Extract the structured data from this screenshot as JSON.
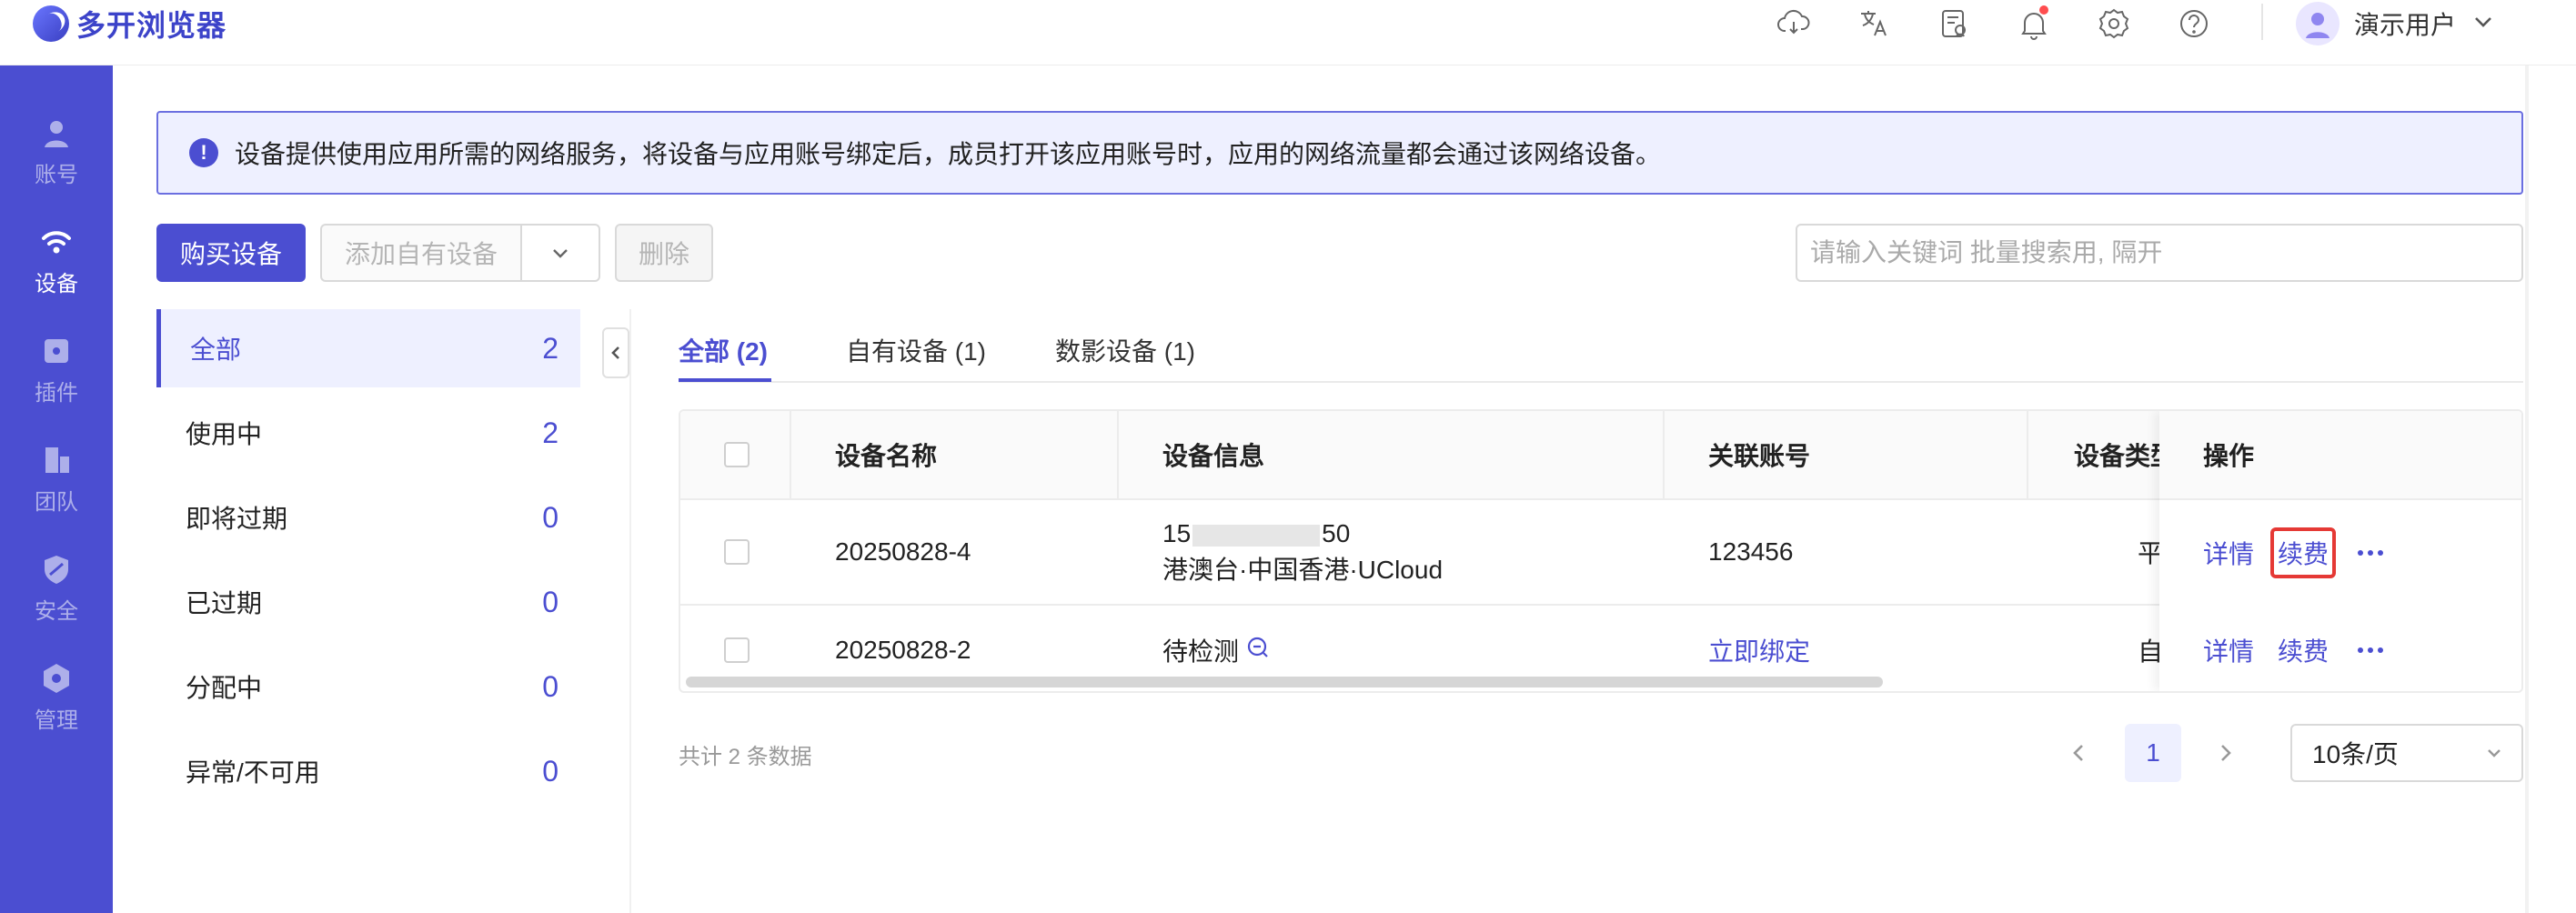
{
  "app": {
    "title": "多开浏览器"
  },
  "user": {
    "name": "演示用户"
  },
  "nav": [
    {
      "label": "账号",
      "icon": "user-icon"
    },
    {
      "label": "设备",
      "icon": "wifi-icon"
    },
    {
      "label": "插件",
      "icon": "puzzle-icon"
    },
    {
      "label": "团队",
      "icon": "building-icon"
    },
    {
      "label": "安全",
      "icon": "shield-icon"
    },
    {
      "label": "管理",
      "icon": "hexagon-icon"
    }
  ],
  "notice": {
    "text": "设备提供使用应用所需的网络服务，将设备与应用账号绑定后，成员打开该应用账号时，应用的网络流量都会通过该网络设备。"
  },
  "toolbar": {
    "buy": "购买设备",
    "add_own": "添加自有设备",
    "delete": "删除",
    "search_placeholder": "请输入关键词 批量搜索用, 隔开"
  },
  "status_filters": [
    {
      "label": "全部",
      "count": "2"
    },
    {
      "label": "使用中",
      "count": "2"
    },
    {
      "label": "即将过期",
      "count": "0"
    },
    {
      "label": "已过期",
      "count": "0"
    },
    {
      "label": "分配中",
      "count": "0"
    },
    {
      "label": "异常/不可用",
      "count": "0"
    }
  ],
  "tabs": [
    {
      "label": "全部 (2)"
    },
    {
      "label": "自有设备 (1)"
    },
    {
      "label": "数影设备 (1)"
    }
  ],
  "table": {
    "headers": {
      "name": "设备名称",
      "info": "设备信息",
      "account": "关联账号",
      "type": "设备类型",
      "ops": "操作"
    },
    "rows": [
      {
        "name": "20250828-4",
        "info_prefix": "15",
        "info_suffix": "50",
        "info_location": "港澳台·中国香港·UCloud",
        "account": "123456",
        "type": "平",
        "op_detail": "详情",
        "op_renew": "续费"
      },
      {
        "name": "20250828-2",
        "info_status": "待检测",
        "account": "立即绑定",
        "type": "自",
        "op_detail": "详情",
        "op_renew": "续费"
      }
    ]
  },
  "pagination": {
    "total": "共计 2 条数据",
    "current": "1",
    "page_size": "10条/页"
  },
  "colors": {
    "accent": "#4b4ed1",
    "highlight": "#e53935"
  }
}
